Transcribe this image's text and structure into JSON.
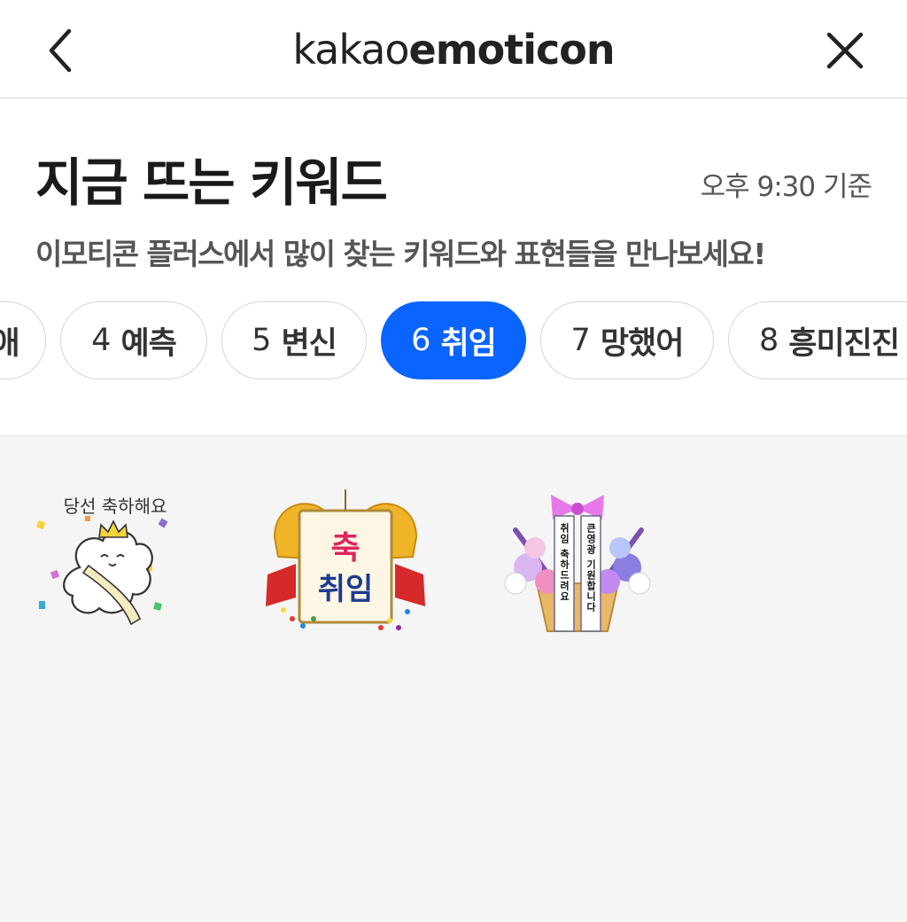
{
  "header": {
    "logo_light": "kakao",
    "logo_bold": "emoticon",
    "back_icon": "chevron-left-icon",
    "close_icon": "close-icon"
  },
  "section": {
    "title": "지금 뜨는 키워드",
    "timestamp": "오후 9:30 기준",
    "subtitle": "이모티콘 플러스에서 많이 찾는 키워드와 표현들을 만나보세요!"
  },
  "keywords": [
    {
      "num": "",
      "label": "애"
    },
    {
      "num": "4",
      "label": "예측"
    },
    {
      "num": "5",
      "label": "변신"
    },
    {
      "num": "6",
      "label": "취임",
      "active": true
    },
    {
      "num": "7",
      "label": "망했어"
    },
    {
      "num": "8",
      "label": "흥미진진"
    }
  ],
  "emoticons": [
    {
      "caption": "당선 축하해요",
      "icon": "cloud-character-crown-icon"
    },
    {
      "caption_top": "축",
      "caption_bottom": "취임",
      "icon": "congratulation-banner-icon"
    },
    {
      "ribbon_left": "취임 축하드려요",
      "ribbon_right": "큰영광 기원합니다",
      "icon": "flower-wreath-icon"
    }
  ],
  "colors": {
    "accent": "#0a64ff",
    "grid_bg": "#f5f5f5"
  }
}
